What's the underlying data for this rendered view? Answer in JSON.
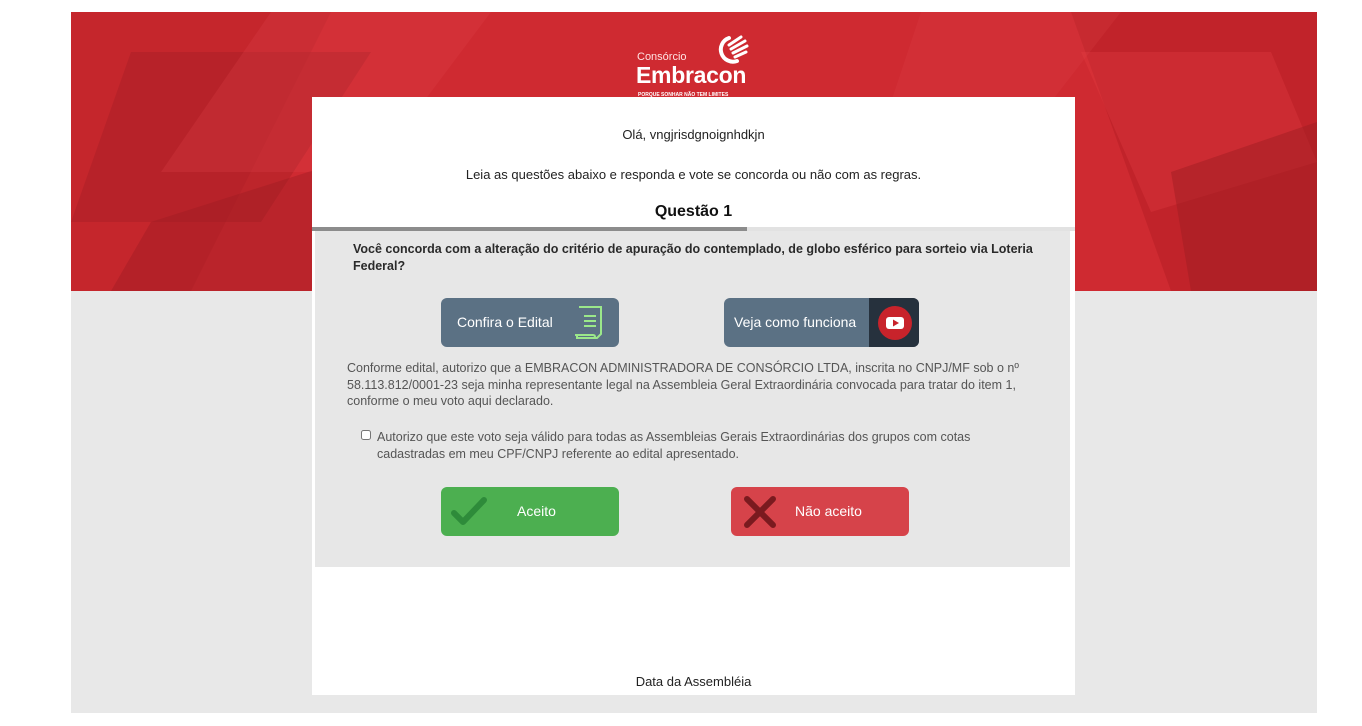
{
  "brand": {
    "small": "Consórcio",
    "name": "Embracon",
    "tagline": "PORQUE SONHAR NÃO TEM LIMITES"
  },
  "colors": {
    "hero_red": "#cf2a31",
    "accept_green": "#4caf50",
    "reject_red": "#d6434a",
    "media_blue": "#5b7184"
  },
  "greeting": "Olá, vngjrisdgnoignhdkjn",
  "instructions": "Leia as questões abaixo  e responda e vote se concorda ou não com as regras.",
  "question": {
    "title": "Questão 1",
    "progress": 0.57,
    "text": "Você concorda com a alteração do critério de apuração do contemplado, de globo esférico para sorteio via Loteria Federal?",
    "edital_button": "Confira o Edital",
    "video_button": "Veja como funciona",
    "legal_text": "Conforme edital, autorizo que a EMBRACON ADMINISTRADORA DE CONSÓRCIO LTDA, inscrita no CNPJ/MF sob o nº 58.113.812/0001-23 seja minha representante legal na Assembleia Geral Extraordinária convocada para tratar do item 1, conforme o meu voto aqui declarado.",
    "checkbox_label": "Autorizo que este voto seja válido para todas as Assembleias Gerais Extraordinárias dos grupos com cotas cadastradas em meu CPF/CNPJ referente ao edital apresentado.",
    "checkbox_checked": false,
    "accept_label": "Aceito",
    "reject_label": "Não aceito"
  },
  "footer": {
    "date_label": "Data da Assembléia"
  },
  "icons": {
    "logo": "embracon-hand-logo-icon",
    "edital": "document-icon",
    "video": "youtube-play-icon",
    "accept": "checkmark-icon",
    "reject": "x-icon"
  }
}
